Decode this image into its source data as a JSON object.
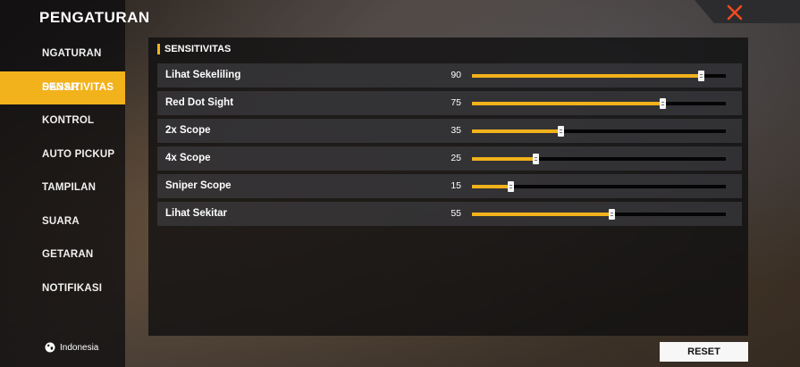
{
  "sidebar": {
    "title": "PENGATURAN",
    "items": [
      {
        "label": "NGATURAN DASAR",
        "active": false
      },
      {
        "label": "SENSITIVITAS",
        "active": true
      },
      {
        "label": "KONTROL",
        "active": false
      },
      {
        "label": "AUTO PICKUP",
        "active": false
      },
      {
        "label": "TAMPILAN",
        "active": false
      },
      {
        "label": "SUARA",
        "active": false
      },
      {
        "label": "GETARAN",
        "active": false
      },
      {
        "label": "NOTIFIKASI",
        "active": false
      }
    ],
    "language": "Indonesia"
  },
  "panel": {
    "title": "SENSITIVITAS",
    "rows": [
      {
        "label": "Lihat Sekeliling",
        "value": 90
      },
      {
        "label": "Red Dot Sight",
        "value": 75
      },
      {
        "label": "2x Scope",
        "value": 35
      },
      {
        "label": "4x Scope",
        "value": 25
      },
      {
        "label": "Sniper Scope",
        "value": 15
      },
      {
        "label": "Lihat Sekitar",
        "value": 55
      }
    ],
    "slider_max": 100
  },
  "reset_label": "RESET",
  "colors": {
    "accent": "#f2b21c",
    "close": "#f04b1e"
  },
  "icons": {
    "close": "close-icon",
    "language": "globe-icon"
  }
}
